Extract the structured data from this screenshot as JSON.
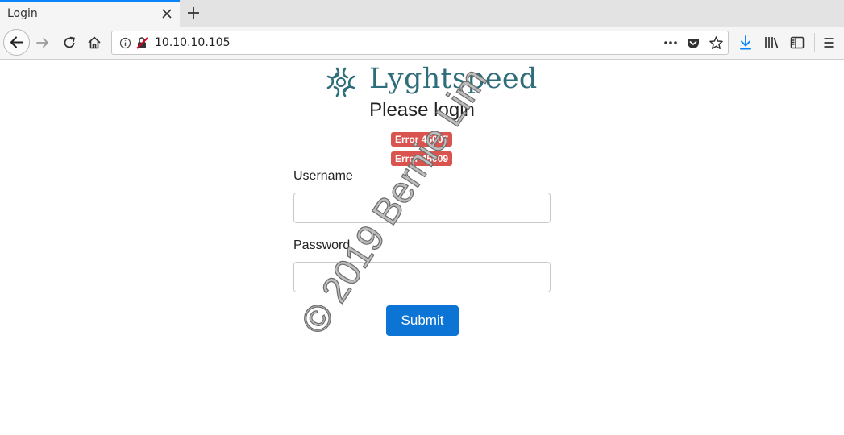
{
  "browser": {
    "tab_title": "Login",
    "url": "10.10.10.105",
    "icons": [
      "close-icon",
      "plus-icon",
      "back-arrow-icon",
      "forward-arrow-icon",
      "reload-icon",
      "home-icon",
      "info-icon",
      "insecure-lock-icon",
      "more-icon",
      "pocket-icon",
      "star-icon",
      "download-icon",
      "library-icon",
      "sidebar-icon",
      "menu-icon"
    ],
    "download_icon_color": "#0a84ff"
  },
  "page": {
    "brand": "Lyghtspeed",
    "brand_color": "#2e6d7a",
    "heading": "Please login",
    "errors": [
      "Error 45007",
      "Error 45009"
    ],
    "error_color": "#d9534f",
    "username_label": "Username",
    "username_value": "",
    "password_label": "Password",
    "password_value": "",
    "submit_label": "Submit",
    "submit_color": "#0b74d4",
    "watermark": "© 2019 Bernie Lim"
  }
}
